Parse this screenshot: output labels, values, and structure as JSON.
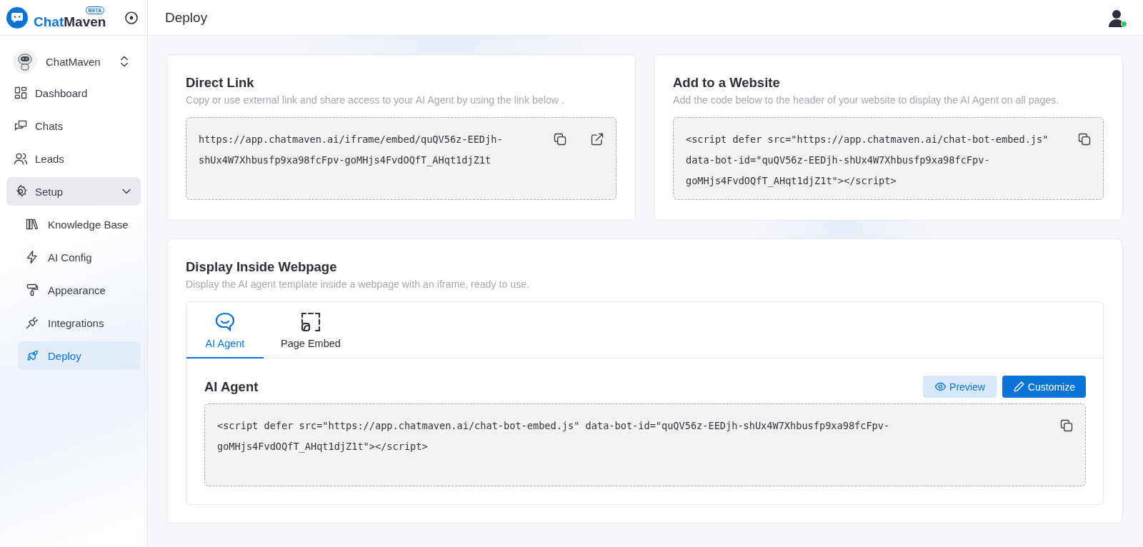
{
  "logo": {
    "text_1": "Chat",
    "text_2": "Maven",
    "badge": "BETA"
  },
  "workspace": {
    "name": "ChatMaven"
  },
  "nav": [
    {
      "label": "Dashboard",
      "selected": false
    },
    {
      "label": "Chats",
      "selected": false
    },
    {
      "label": "Leads",
      "selected": false
    },
    {
      "label": "Setup",
      "selected": false,
      "expanded": true,
      "children": [
        {
          "label": "Knowledge Base",
          "selected": false
        },
        {
          "label": "AI Config",
          "selected": false
        },
        {
          "label": "Appearance",
          "selected": false
        },
        {
          "label": "Integrations",
          "selected": false
        },
        {
          "label": "Deploy",
          "selected": true
        }
      ]
    }
  ],
  "header": {
    "title": "Deploy",
    "user_online": true
  },
  "direct_link": {
    "title": "Direct Link",
    "description": "Copy or use external link and share access to your AI Agent by using the link below .",
    "code": "https://app.chatmaven.ai/iframe/embed/quQV56z-EEDjh-shUx4W7Xhbusfp9xa98fcFpv-goMHjs4FvdOQfT_AHqt1djZ1t"
  },
  "website": {
    "title": "Add to a Website",
    "description": "Add the code below to the header of your website to display the AI Agent on all pages.",
    "code": "<script defer src=\"https://app.chatmaven.ai/chat-bot-embed.js\" data-bot-id=\"quQV56z-EEDjh-shUx4W7Xhbusfp9xa98fcFpv-goMHjs4FvdOQfT_AHqt1djZ1t\"></script>"
  },
  "display": {
    "title": "Display Inside Webpage",
    "description": "Display the AI agent template inside a webpage with an iframe, ready to use.",
    "tabs": [
      {
        "label": "AI Agent",
        "selected": true
      },
      {
        "label": "Page Embed",
        "selected": false
      }
    ],
    "panel": {
      "title": "AI Agent",
      "preview_button": "Preview",
      "customize_button": "Customize",
      "code": "<script defer src=\"https://app.chatmaven.ai/chat-bot-embed.js\" data-bot-id=\"quQV56z-EEDjh-shUx4W7Xhbusfp9xa98fcFpv-goMHjs4FvdOQfT_AHqt1djZ1t\"></script>"
    }
  }
}
